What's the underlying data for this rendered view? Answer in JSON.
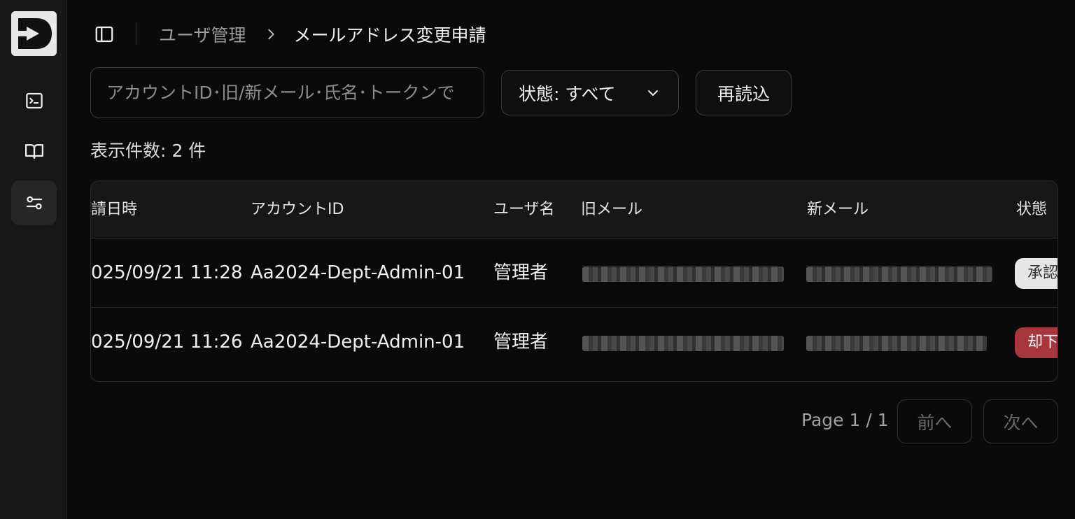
{
  "colors": {
    "background": "#0a0a0a",
    "sidebar": "#171717",
    "approved_badge": "#e6e6e6",
    "rejected_badge": "#a8373d"
  },
  "sidebar": {
    "logo_icon": "d-logo-icon",
    "items": [
      {
        "icon": "terminal-icon",
        "active": false
      },
      {
        "icon": "book-open-icon",
        "active": false
      },
      {
        "icon": "settings-sliders-icon",
        "active": true
      }
    ]
  },
  "header": {
    "toggle_icon": "sidebar-toggle-icon",
    "breadcrumb": {
      "parent": "ユーザ管理",
      "separator_icon": "chevron-right-icon",
      "current": "メールアドレス変更申請"
    }
  },
  "toolbar": {
    "search_placeholder": "アカウントID･旧/新メール･氏名･トークンで",
    "search_value": "",
    "status_filter": "状態: すべて",
    "status_icon": "chevron-down-icon",
    "reload_label": "再読込"
  },
  "summary": {
    "label": "表示件数:",
    "count": "2 件"
  },
  "table": {
    "columns": [
      "請日時",
      "アカウントID",
      "ユーザ名",
      "旧メール",
      "新メール",
      "状態"
    ],
    "rows": [
      {
        "date": "025/09/21 11:28",
        "account_id": "Aa2024-Dept-Admin-01",
        "user_name": "管理者",
        "old_email": "(blurred)",
        "new_email": "(blurred)",
        "status": "承認",
        "status_type": "approved"
      },
      {
        "date": "025/09/21 11:26",
        "account_id": "Aa2024-Dept-Admin-01",
        "user_name": "管理者",
        "old_email": "(blurred)",
        "new_email": "(blurred)",
        "status": "却下",
        "status_type": "rejected"
      }
    ]
  },
  "pagination": {
    "page_info": "Page 1 / 1",
    "prev_label": "前へ",
    "next_label": "次へ"
  }
}
